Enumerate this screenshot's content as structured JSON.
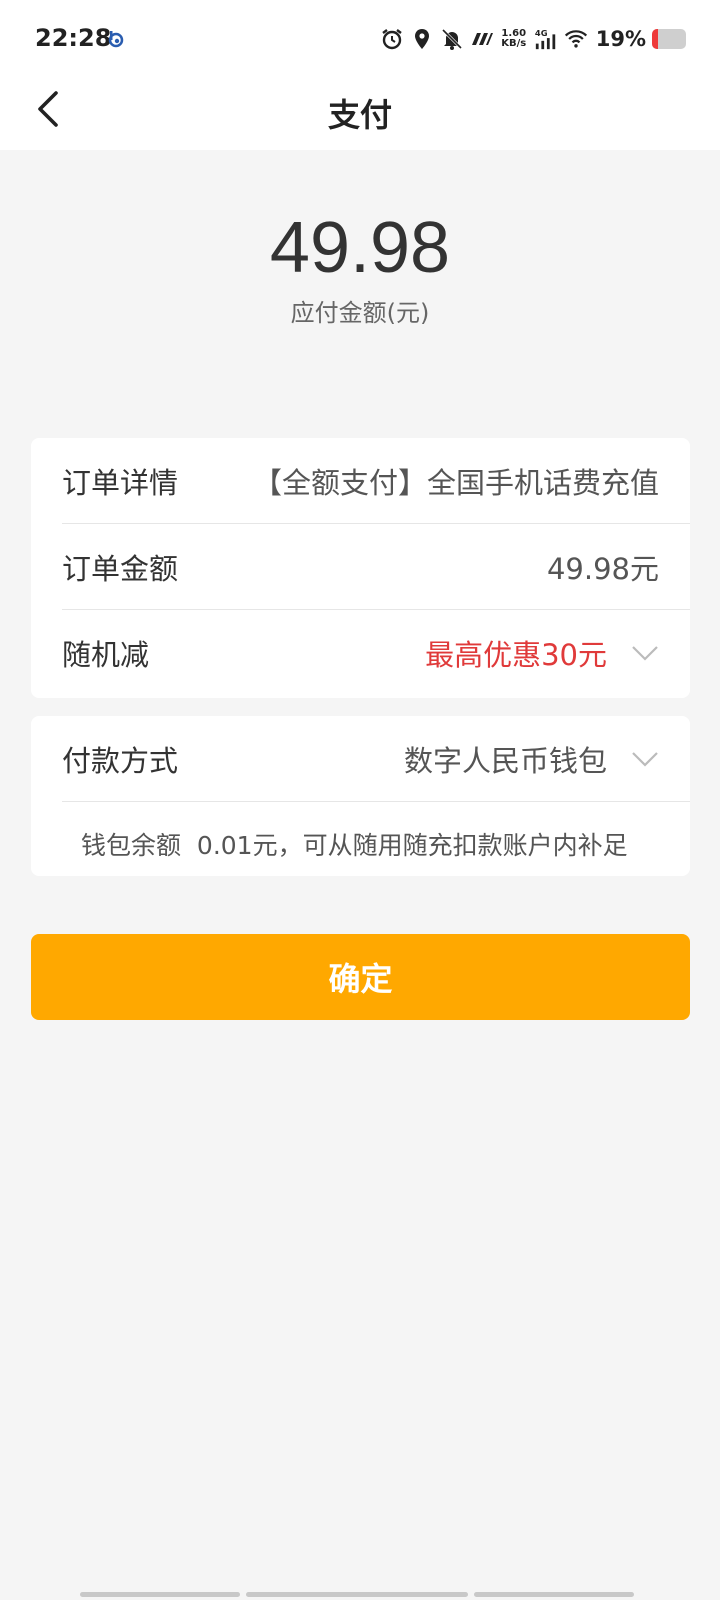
{
  "status_bar": {
    "time": "22:28",
    "net_speed_value": "1.60",
    "net_speed_unit": "KB/s",
    "network_type": "4G",
    "battery_percent_text": "19%",
    "battery_level": 0.19,
    "icons": [
      "baidu-icon",
      "alarm-icon",
      "location-icon",
      "mute-bell-icon",
      "nfc-icon",
      "signal-icon",
      "wifi-icon",
      "battery-icon"
    ]
  },
  "nav": {
    "title": "支付"
  },
  "amount": {
    "value": "49.98",
    "label": "应付金额(元)"
  },
  "order": {
    "detail_label": "订单详情",
    "detail_value": "【全额支付】全国手机话费充值",
    "amount_label": "订单金额",
    "amount_value": "49.98元",
    "discount_label": "随机减",
    "discount_value": "最高优惠30元"
  },
  "payment": {
    "method_label": "付款方式",
    "method_value": "数字人民币钱包",
    "wallet_note_prefix": "钱包余额",
    "wallet_note_body": "0.01元，可从随用随充扣款账户内补足"
  },
  "confirm_label": "确定",
  "colors": {
    "accent": "#ffa800",
    "discount_red": "#e03a3a",
    "background": "#f5f5f5"
  }
}
